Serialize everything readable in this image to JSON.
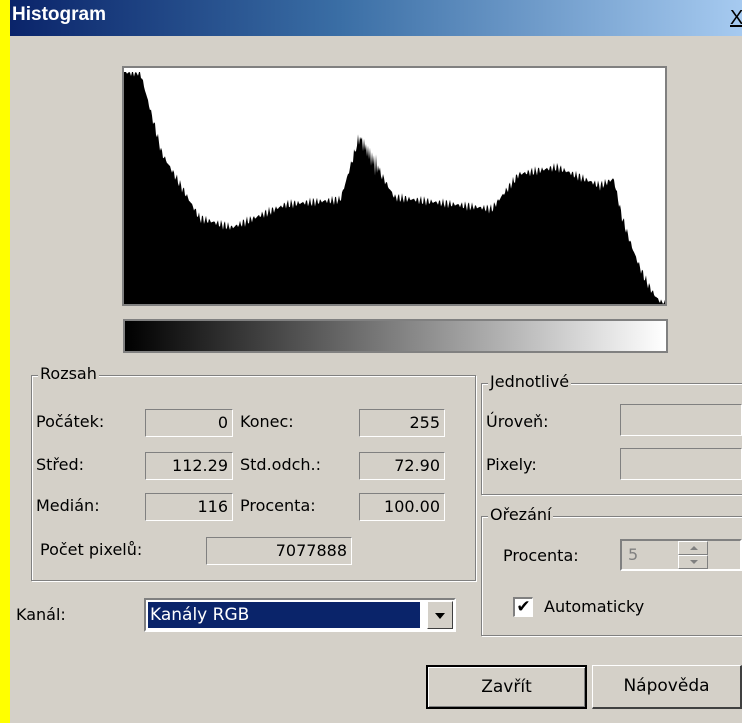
{
  "window": {
    "title": "Histogram",
    "close_glyph": "X"
  },
  "histogram": {
    "channel": "luminosity",
    "fill_color": "#000000",
    "gradient": [
      "#000000",
      "#ffffff"
    ]
  },
  "range_group": {
    "legend": "Rozsah",
    "start_label": "Počátek:",
    "start_value": "0",
    "end_label": "Konec:",
    "end_value": "255",
    "mean_label": "Střed:",
    "mean_value": "112.29",
    "stddev_label": "Std.odch.:",
    "stddev_value": "72.90",
    "median_label": "Medián:",
    "median_value": "116",
    "percent_label": "Procenta:",
    "percent_value": "100.00",
    "pixel_count_label": "Počet pixelů:",
    "pixel_count_value": "7077888"
  },
  "single_group": {
    "legend": "Jednotlivé",
    "level_label": "Úroveň:",
    "level_value": "",
    "pixels_label": "Pixely:",
    "pixels_value": ""
  },
  "clip_group": {
    "legend": "Ořezání",
    "percent_label": "Procenta:",
    "percent_value": "5",
    "auto_label": "Automaticky",
    "auto_checked": true,
    "check_glyph": "✔"
  },
  "channel_select": {
    "label": "Kanál:",
    "value": "Kanály RGB"
  },
  "buttons": {
    "close_label": "Zavřít",
    "help_label": "Nápověda"
  }
}
